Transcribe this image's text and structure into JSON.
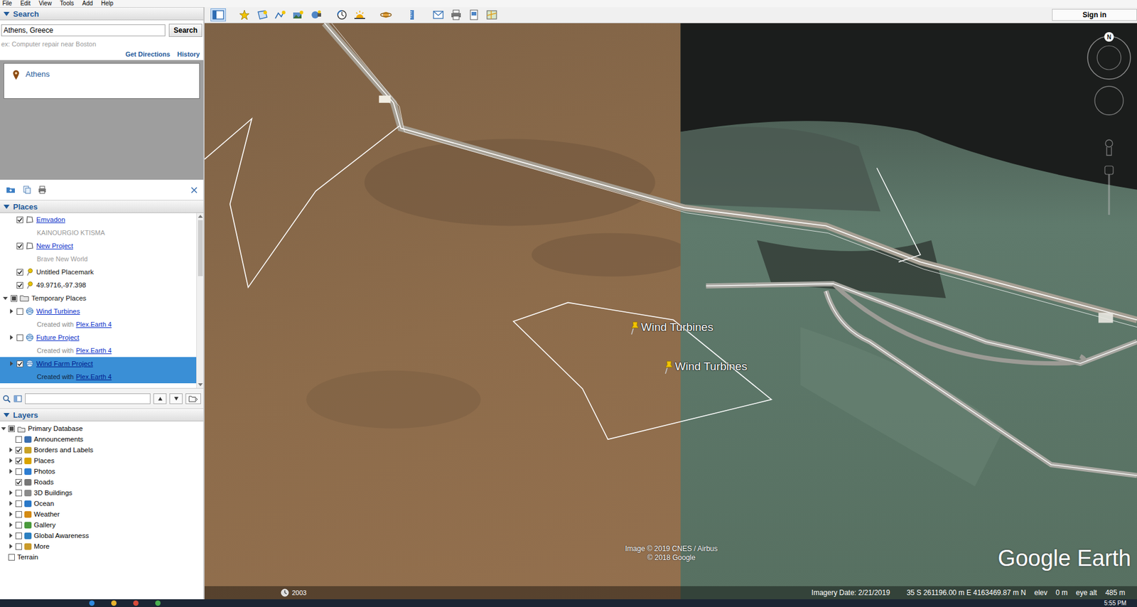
{
  "menu": [
    "File",
    "Edit",
    "View",
    "Tools",
    "Add",
    "Help"
  ],
  "search": {
    "title": "Search",
    "expanded": true,
    "query": "Athens, Greece",
    "button": "Search",
    "hint": "ex: Computer repair near Boston",
    "links": [
      "Get Directions",
      "History"
    ],
    "results": [
      {
        "label": "Athens"
      }
    ]
  },
  "places": {
    "title": "Places",
    "expanded": true,
    "my_places_items": [
      {
        "kind": "polygon",
        "label": "Emvadon",
        "link": true,
        "checked": true,
        "partial": false,
        "expandable": false,
        "expanded": false,
        "selected": false,
        "description": "KAINOURGIO KTISMA"
      },
      {
        "kind": "polygon",
        "label": "New Project",
        "link": true,
        "checked": true,
        "partial": false,
        "expandable": false,
        "expanded": false,
        "selected": false,
        "description": "Brave New World"
      },
      {
        "kind": "pin",
        "label": "Untitled Placemark",
        "link": false,
        "checked": true,
        "partial": false,
        "expandable": false,
        "expanded": false,
        "selected": false
      },
      {
        "kind": "pin",
        "label": "49.9716,-97.398",
        "link": false,
        "checked": true,
        "partial": false,
        "expandable": false,
        "expanded": false,
        "selected": false
      }
    ],
    "folders": [
      {
        "kind": "folder",
        "label": "Temporary Places",
        "link": false,
        "checked": true,
        "partial": true,
        "expandable": true,
        "expanded": true,
        "selected": false,
        "children": [
          {
            "kind": "kml",
            "label": "Wind Turbines",
            "link": true,
            "checked": false,
            "partial": false,
            "expandable": true,
            "expanded": false,
            "selected": false,
            "credit": {
              "prefix": "Created with",
              "link": "Plex.Earth 4"
            }
          },
          {
            "kind": "kml",
            "label": "Future Project",
            "link": true,
            "checked": false,
            "partial": false,
            "expandable": true,
            "expanded": false,
            "selected": false,
            "credit": {
              "prefix": "Created with",
              "link": "Plex.Earth 4"
            }
          },
          {
            "kind": "kml",
            "label": "Wind Farm Project",
            "link": true,
            "checked": true,
            "partial": false,
            "expandable": true,
            "expanded": false,
            "selected": true,
            "credit": {
              "prefix": "Created with",
              "link": "Plex.Earth 4"
            }
          }
        ]
      }
    ]
  },
  "layers": {
    "title": "Layers",
    "expanded": true,
    "root": {
      "label": "Primary Database",
      "checked": true,
      "partial": true,
      "expanded": true
    },
    "items": [
      {
        "label": "Announcements",
        "checked": false,
        "expandable": false
      },
      {
        "label": "Borders and Labels",
        "checked": true,
        "expandable": true
      },
      {
        "label": "Places",
        "checked": true,
        "expandable": true
      },
      {
        "label": "Photos",
        "checked": false,
        "expandable": true
      },
      {
        "label": "Roads",
        "checked": true,
        "expandable": false
      },
      {
        "label": "3D Buildings",
        "checked": false,
        "expandable": true
      },
      {
        "label": "Ocean",
        "checked": false,
        "expandable": true
      },
      {
        "label": "Weather",
        "checked": false,
        "expandable": true
      },
      {
        "label": "Gallery",
        "checked": false,
        "expandable": true
      },
      {
        "label": "Global Awareness",
        "checked": false,
        "expandable": true
      },
      {
        "label": "More",
        "checked": false,
        "expandable": true
      }
    ],
    "terrain": {
      "label": "Terrain",
      "checked": false
    }
  },
  "toolbar": {
    "sidebar_on": true,
    "sign_in": "Sign in"
  },
  "map": {
    "compass": "N",
    "placemarks": [
      {
        "label": "Wind Turbines"
      },
      {
        "label": "Wind Turbines"
      }
    ],
    "attribution": [
      "Image © 2019 CNES / Airbus",
      "© 2018 Google"
    ],
    "logo": "Google Earth",
    "historical_year": "2003",
    "status": {
      "imagery_date": "Imagery Date: 2/21/2019",
      "coordinates": "35 S 261196.00 m E 4163469.87 m N",
      "elev_label": "elev",
      "elev": "0 m",
      "eye_alt_label": "eye alt",
      "eye_alt": "485 m"
    }
  },
  "taskbar": {
    "time": "5:55 PM"
  }
}
